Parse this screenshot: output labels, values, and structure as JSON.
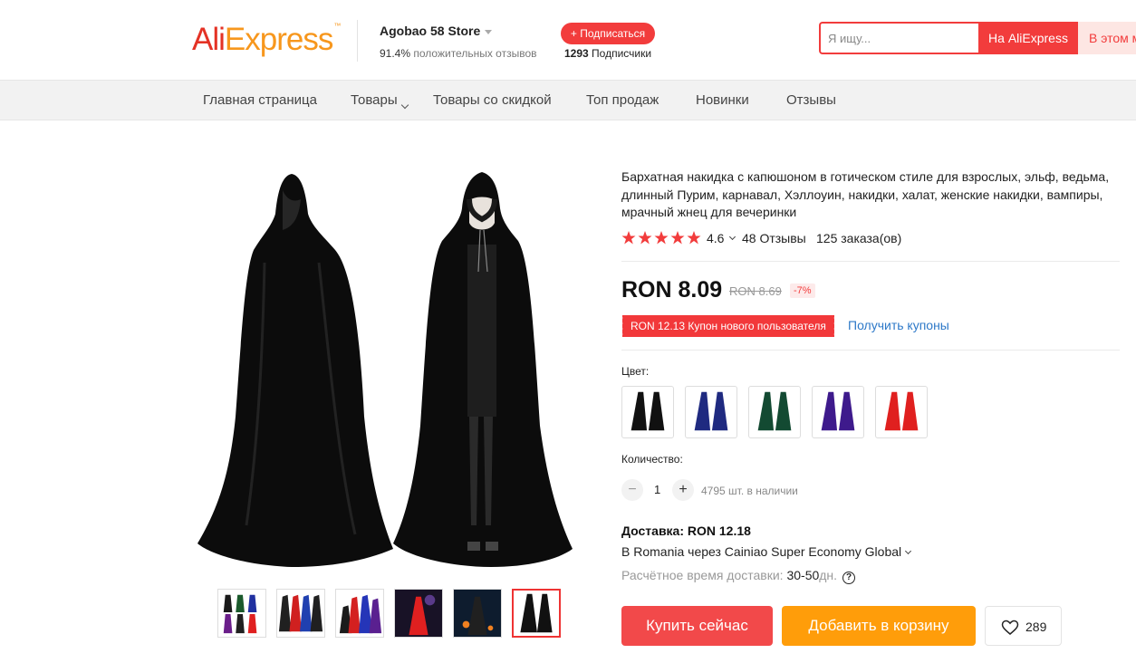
{
  "header": {
    "logo": {
      "ali": "Ali",
      "express": "Express",
      "tm": "™"
    },
    "store_name": "Agobao 58 Store",
    "positive_percent": "91.4%",
    "positive_label": "положительных отзывов",
    "follow_label": "+ Подписаться",
    "followers_count": "1293",
    "followers_label": "Подписчики",
    "search_placeholder": "Я ищу...",
    "search_button": "На AliExpress",
    "search_store_button": "В этом магазине"
  },
  "nav": {
    "items": [
      {
        "label": "Главная страница"
      },
      {
        "label": "Товары",
        "has_caret": true
      },
      {
        "label": "Товары со скидкой"
      },
      {
        "label": "Топ продаж"
      },
      {
        "label": "Новинки"
      },
      {
        "label": "Отзывы"
      }
    ]
  },
  "product": {
    "title": "Бархатная накидка с капюшоном в готическом стиле для взрослых, эльф, ведьма, длинный Пурим, карнавал, Хэллоуин, накидки, халат, женские накидки, вампиры, мрачный жнец для вечеринки",
    "rating": "4.6",
    "stars": 5,
    "reviews": "48 Отзывы",
    "orders": "125 заказа(ов)",
    "price": "RON 8.09",
    "old_price": "RON 8.69",
    "discount": "-7%",
    "coupon": "RON 12.13 Купон нового пользователя",
    "coupon_link": "Получить купоны",
    "color_label": "Цвет:",
    "colors": [
      {
        "name": "black",
        "hex": "#111111"
      },
      {
        "name": "navy",
        "hex": "#1f2a80"
      },
      {
        "name": "green",
        "hex": "#134a32"
      },
      {
        "name": "purple",
        "hex": "#3e1a8c"
      },
      {
        "name": "red",
        "hex": "#e0201f"
      }
    ],
    "quantity_label": "Количество:",
    "quantity": "1",
    "minus": "−",
    "plus": "+",
    "stock": "4795 шт. в наличии",
    "shipping_title": "Доставка: RON 12.18",
    "shipping_route": "В Romania через Cainiao Super Economy Global",
    "eta_label": "Расчётное время доставки:",
    "eta_value": "30-50",
    "eta_unit": "дн.",
    "help": "?",
    "buy_now": "Купить сейчас",
    "add_to_cart": "Добавить в корзину",
    "wishlist_count": "289"
  },
  "gallery": {
    "thumbnails": [
      {
        "colors": [
          "#1a1a1a",
          "#1b5a2c",
          "#2030a0",
          "#6a1e8a",
          "#e02020",
          "#202020"
        ]
      },
      {
        "colors": [
          "#202020",
          "#d02020",
          "#2040b0",
          "#202020"
        ]
      },
      {
        "colors": [
          "#1b1b1b",
          "#d42020",
          "#2535b8",
          "#5a2090"
        ]
      },
      {
        "colors": [
          "#e02020"
        ]
      },
      {
        "colors": [
          "#202020"
        ]
      },
      {
        "colors": [
          "#111111",
          "#111111"
        ]
      }
    ],
    "active_index": 5
  },
  "colors": {
    "accent_red": "#f23c3c",
    "buy_button": "#f2494a",
    "cart_button": "#ff9d0a",
    "link_blue": "#2e79c8",
    "star": "#f23c3c"
  }
}
